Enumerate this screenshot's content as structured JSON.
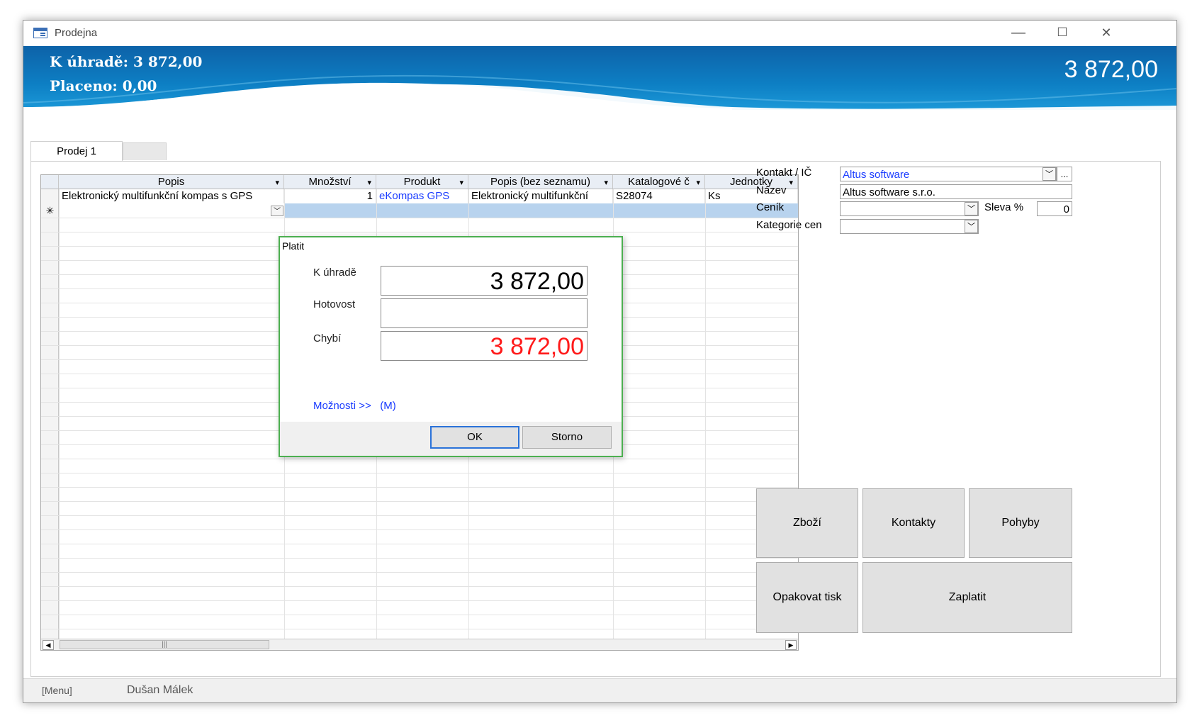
{
  "window": {
    "title": "Prodejna",
    "controls": [
      "—",
      "☐",
      "✕"
    ]
  },
  "header": {
    "k_uhrade": "K úhradě: 3 872,00",
    "placeno": "Placeno: 0,00",
    "amount": "3 872,00"
  },
  "tabs": [
    {
      "label": "Prodej 1"
    }
  ],
  "grid": {
    "columns": [
      "Popis",
      "Množství",
      "Produkt",
      "Popis (bez seznamu)",
      "Katalogové č",
      "Jednotky"
    ],
    "rows": [
      {
        "popis": "Elektronický multifunkční kompas s GPS",
        "mnozstvi": "1",
        "produkt": "eKompas GPS",
        "popis_bez": "Elektronický multifunkční",
        "katalog": "S28074",
        "jednotky": "Ks"
      }
    ],
    "newrow_marker": "✳"
  },
  "form": {
    "kontakt_label": "Kontakt / IČ",
    "kontakt_value": "Altus software",
    "kontakt_more": "...",
    "nazev_label": "Název",
    "nazev_value": "Altus software s.r.o.",
    "cenik_label": "Ceník",
    "cenik_value": "",
    "sleva_label": "Sleva %",
    "sleva_value": "0",
    "kategorie_label": "Kategorie cen",
    "kategorie_value": ""
  },
  "buttons": {
    "zbozi": "Zboží",
    "kontakty": "Kontakty",
    "pohyby": "Pohyby",
    "opakovat": "Opakovat tisk",
    "zaplatit": "Zaplatit"
  },
  "statusbar": {
    "menu": "[Menu]",
    "user": "Dušan Málek"
  },
  "dialog": {
    "title": "Platit",
    "k_uhrade_label": "K úhradě",
    "k_uhrade_value": "3 872,00",
    "hotovost_label": "Hotovost",
    "hotovost_value": "",
    "chybi_label": "Chybí",
    "chybi_value": "3 872,00",
    "moznosti": "Možnosti >>",
    "moznosti_key": "(M)",
    "ok": "OK",
    "storno": "Storno"
  },
  "colors": {
    "header_blue": "#0d7fc4",
    "link_blue": "#1a3cff",
    "missing_red": "#ff1a1a",
    "dialog_border": "#4caf50"
  }
}
